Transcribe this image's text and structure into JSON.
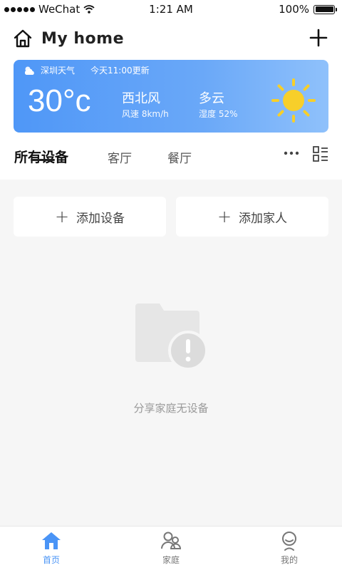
{
  "status_bar": {
    "carrier": "WeChat",
    "time": "1:21 AM",
    "battery": "100%"
  },
  "header": {
    "title": "My home",
    "home_icon": "home-icon",
    "add_icon": "plus-icon"
  },
  "weather": {
    "location_label": "深圳天气",
    "updated": "今天11:00更新",
    "temperature": "30°c",
    "wind_direction": "西北风",
    "wind_speed": "风速 8km/h",
    "condition": "多云",
    "humidity": "湿度 52%",
    "icon": "sun-icon",
    "colors": {
      "gradient_start": "#4f97f7",
      "gradient_end": "#8fc1fb",
      "sun": "#f7cf2a"
    }
  },
  "tabs": [
    {
      "label": "所有设备",
      "active": true
    },
    {
      "label": "客厅",
      "active": false
    },
    {
      "label": "餐厅",
      "active": false
    }
  ],
  "actions": {
    "add_device": "添加设备",
    "add_family": "添加家人"
  },
  "empty_state": {
    "message": "分享家庭无设备",
    "icon": "empty-folder-warning-icon"
  },
  "bottom_nav": [
    {
      "label": "首页",
      "icon": "home-filled-icon",
      "active": true
    },
    {
      "label": "家庭",
      "icon": "family-icon",
      "active": false
    },
    {
      "label": "我的",
      "icon": "profile-icon",
      "active": false
    }
  ],
  "accent_color": "#4a94f6"
}
